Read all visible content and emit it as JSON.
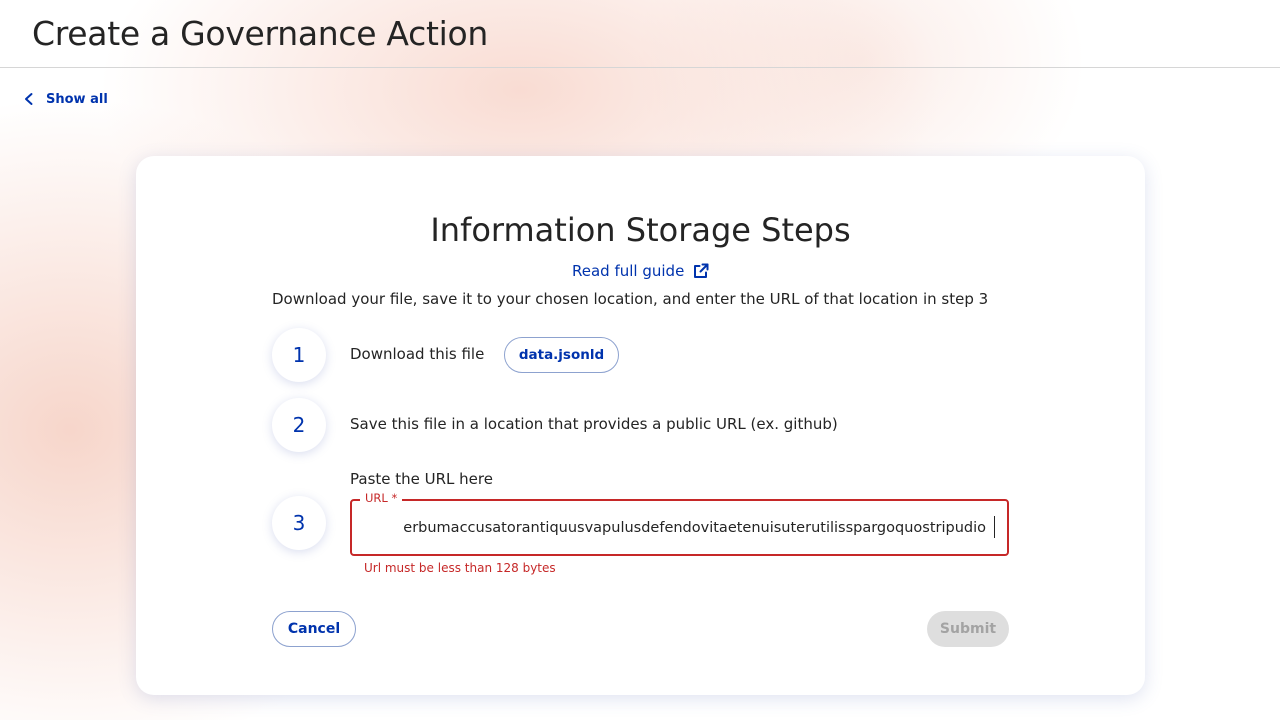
{
  "header": {
    "title": "Create a Governance Action"
  },
  "nav": {
    "back_label": "Show all"
  },
  "card": {
    "title": "Information Storage Steps",
    "guide_link": "Read full guide",
    "intro": "Download your file, save it to your chosen location, and enter the URL of that location in step 3",
    "steps": [
      {
        "number": "1",
        "text": "Download this file",
        "file_button": "data.jsonld"
      },
      {
        "number": "2",
        "text": "Save this file in a location that provides a public URL (ex. github)"
      },
      {
        "number": "3",
        "text": "Paste the URL here"
      }
    ],
    "url_field": {
      "label": "URL *",
      "value": "erbumaccusatorantiquusvapulusdefendovitaetenuisuterutilisspargoquostripudio",
      "error": "Url must be less than 128 bytes"
    },
    "cancel_label": "Cancel",
    "submit_label": "Submit"
  },
  "colors": {
    "primary": "#0033ad",
    "error": "#c62828",
    "disabled_bg": "#dedede",
    "disabled_text": "#a3a3a3"
  },
  "icons": {
    "back": "chevron-left-icon",
    "guide": "external-link-icon"
  }
}
